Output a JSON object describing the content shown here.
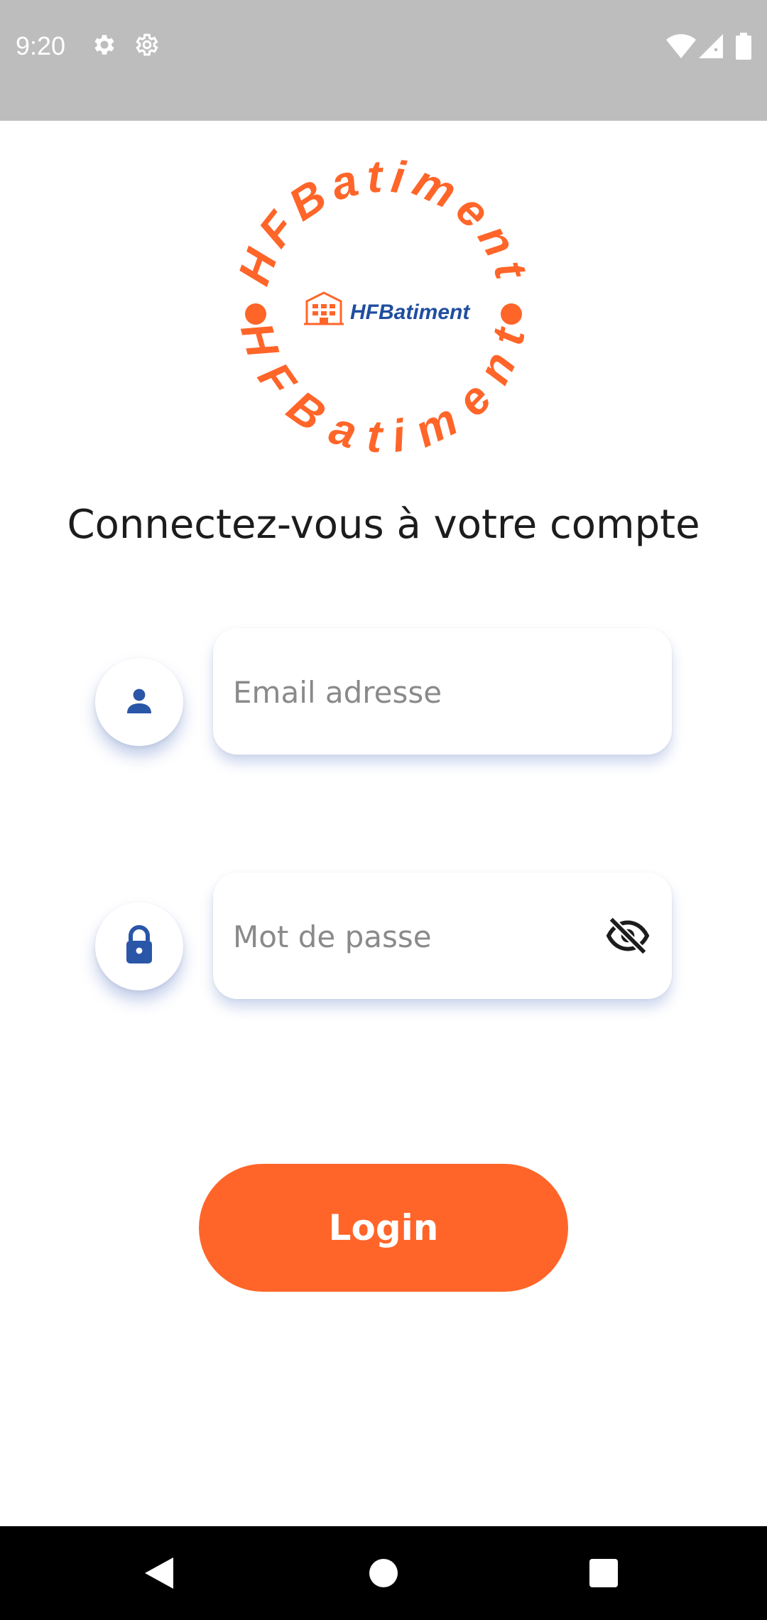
{
  "status_bar": {
    "time": "9:20",
    "icons": [
      "settings-icon",
      "settings-outline-icon",
      "wifi-icon",
      "cellular-signal-icon",
      "battery-icon"
    ]
  },
  "logo": {
    "ring_text": "HFBatiment",
    "inner_text": "HFBatiment",
    "ring_color": "#ff6529",
    "inner_text_color": "#1f4ea0"
  },
  "login": {
    "heading": "Connectez-vous à votre compte",
    "email": {
      "placeholder": "Email adresse",
      "value": "",
      "icon": "person-icon"
    },
    "password": {
      "placeholder": "Mot de passe",
      "value": "",
      "icon": "lock-icon",
      "toggle_icon": "eye-off-icon"
    },
    "button_label": "Login"
  },
  "nav_bar": {
    "buttons": [
      "back-icon",
      "home-icon",
      "recents-icon"
    ]
  },
  "colors": {
    "accent": "#ff6529",
    "brand_blue": "#1f4ea0",
    "status_bar": "#bdbdbd",
    "nav_bar": "#000000"
  }
}
